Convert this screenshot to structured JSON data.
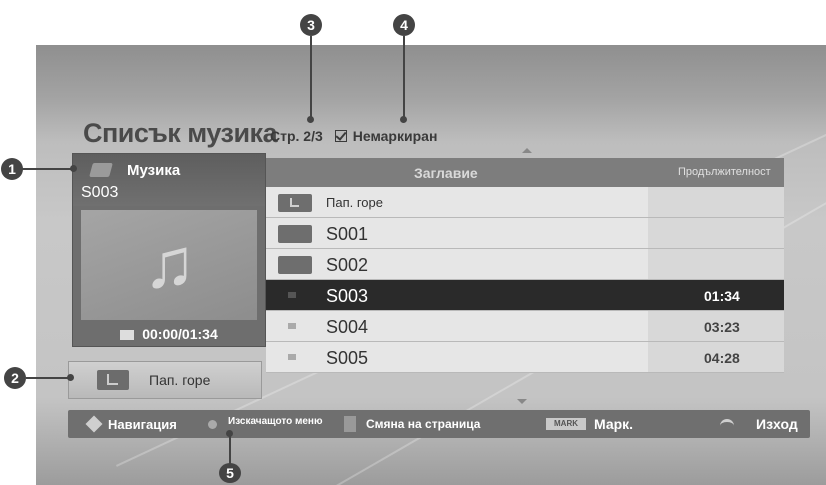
{
  "screen": {
    "title": "Списък музика",
    "page_info": "Стр. 2/3",
    "unmarked_label": "Немаркиран"
  },
  "now_playing": {
    "category": "Музика",
    "file": "S003",
    "time": "00:00/01:34"
  },
  "up_button_label": "Пап. горе",
  "list": {
    "col_title": "Заглавие",
    "col_duration": "Продължителност",
    "rows": [
      {
        "name": "Пап. горе",
        "duration": "",
        "type": "folder-up"
      },
      {
        "name": "S001",
        "duration": "",
        "type": "folder"
      },
      {
        "name": "S002",
        "duration": "",
        "type": "folder"
      },
      {
        "name": "S003",
        "duration": "01:34",
        "type": "file",
        "selected": true
      },
      {
        "name": "S004",
        "duration": "03:23",
        "type": "file"
      },
      {
        "name": "S005",
        "duration": "04:28",
        "type": "file"
      }
    ]
  },
  "footer": {
    "navigation": "Навигация",
    "popup_menu": "Изскачащото меню",
    "page_change": "Смяна на страница",
    "mark_key": "MARK",
    "mark": "Марк.",
    "exit": "Изход"
  },
  "callouts": [
    "1",
    "2",
    "3",
    "4",
    "5"
  ]
}
